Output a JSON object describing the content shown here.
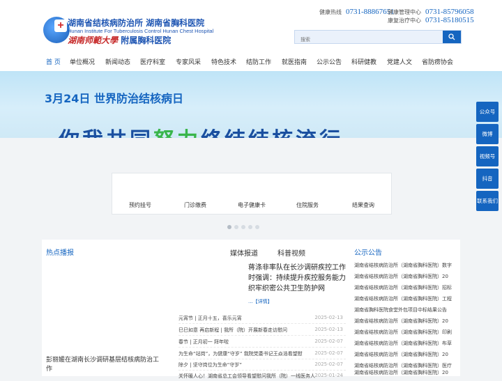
{
  "header": {
    "org_cn": "湖南省结核病防治所  湖南省胸科医院",
    "org_en": "Hunan Institute For Tuberculosis Control    Hunan Chest Hospital",
    "univ_script": "湖南师範大學",
    "univ_hospital": "附属胸科医院",
    "hotlines": [
      {
        "label": "健康热线",
        "number": "0731-88867651"
      },
      {
        "label": "健康管理中心",
        "number": "0731-85796058"
      },
      {
        "label": "康复治疗中心",
        "number": "0731-85180515"
      }
    ],
    "search_placeholder": "搜索"
  },
  "nav": {
    "items": [
      "首 页",
      "单位概况",
      "新闻动态",
      "医疗科室",
      "专家风采",
      "特色技术",
      "结防工作",
      "就医指南",
      "公示公告",
      "科研健教",
      "党建人文",
      "省防痨协会"
    ]
  },
  "banner": {
    "title": "3月24日   世界防治结核病日",
    "slogan_a": "你我共同",
    "slogan_b": "努力",
    "slogan_c": "终结",
    "slogan_d": "结核流行"
  },
  "services": [
    "预约挂号",
    "门诊缴费",
    "电子健康卡",
    "住院服务",
    "结果查询"
  ],
  "carousel": {
    "count": 5,
    "active": 0
  },
  "hot": {
    "title": "热点播报",
    "caption": "彭丽媛在湖南长沙调研基层结核病防治工作"
  },
  "media": {
    "tabs": [
      "媒体报道",
      "科普视频"
    ],
    "headline": "蒋涤非率队在长沙调研疾控工作时强调：持续提升疾控服务能力 织牢织密公共卫生防护网",
    "more": "...【详情】",
    "news": [
      {
        "title": "元宵节 | 正月十五，喜乐元宵",
        "date": "2025-02-13"
      },
      {
        "title": "巳巳如意 再启新程 | 我所（院）开展新春走访慰问",
        "date": "2025-02-13"
      },
      {
        "title": "春节 | 正月初一 拜年啦",
        "date": "2025-02-07"
      },
      {
        "title": "为生命“站岗”，为健康“守岁” 我院党委书记王焱浩看望慰",
        "date": "2025-02-07"
      },
      {
        "title": "除夕 | 坚守岗位为生命“守岁”",
        "date": "2025-02-07"
      },
      {
        "title": "关怀暖人心！湖南省总工会领导看望慰问我所（院）一线医务人",
        "date": "2025-01-24"
      }
    ]
  },
  "notices": {
    "title": "公示公告",
    "items": [
      "湖南省结核病防治所（湖南省胸科医院）数字",
      "湖南省结核病防治所（湖南省胸科医院）20",
      "湖南省结核病防治所（湖南省胸科医院）招标",
      "湖南省结核病防治所（湖南省胸科医院）工程",
      "湖南省胸科医院食堂外包项目中标结果公告",
      "湖南省结核病防治所（湖南省胸科医院）20",
      "湖南省结核病防治所（湖南省胸科医院）印刷",
      "湖南省结核病防治所（湖南省胸科医院）布草",
      "湖南省结核病防治所（湖南省胸科医院）20",
      "湖南省结核病防治所（湖南省胸科医院）医疗",
      "湖南省结核病防治所（湖南省胸科医院）20"
    ]
  },
  "side": [
    "公众号",
    "微博",
    "视频号",
    "抖音",
    "联系我们"
  ],
  "colors": {
    "brand": "#1565c0",
    "accent_green": "#39b54a"
  }
}
